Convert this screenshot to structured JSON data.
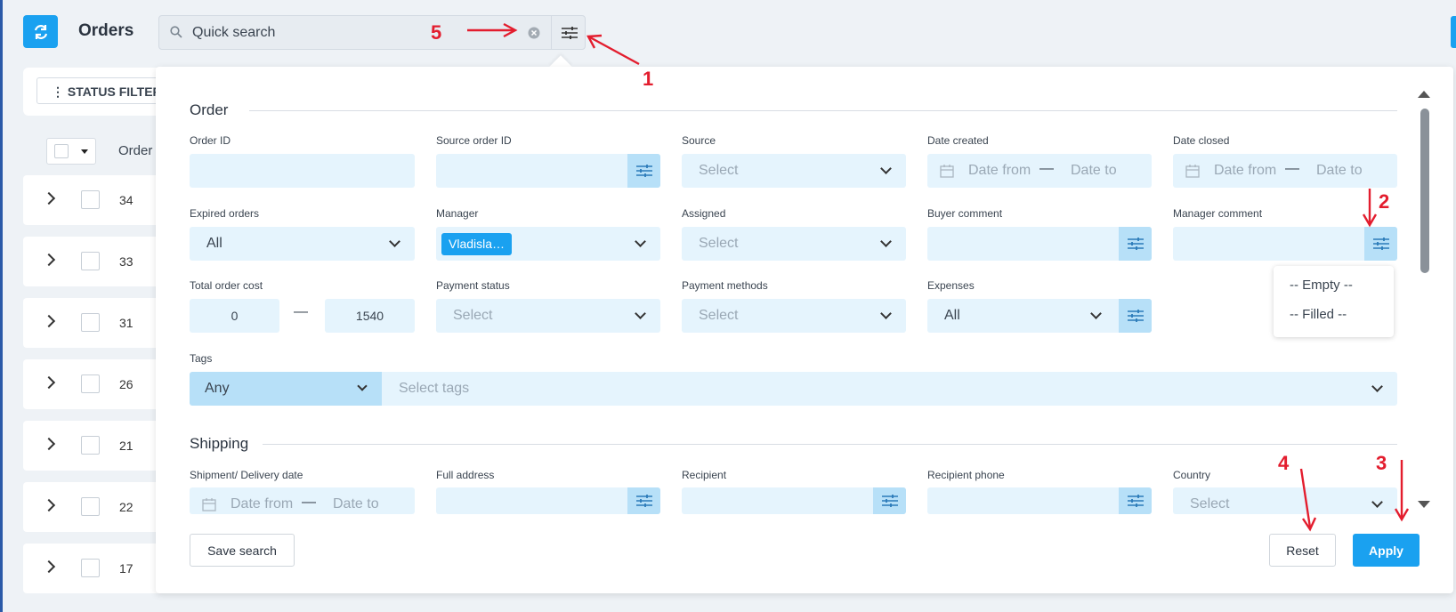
{
  "header": {
    "title": "Orders",
    "search_text": "Quick search"
  },
  "toolbar": {
    "status_filter_label": "⋮ STATUS FILTER"
  },
  "list": {
    "column_order": "Order",
    "rows": [
      "34",
      "33",
      "31",
      "26",
      "21",
      "22",
      "17"
    ]
  },
  "filter_panel": {
    "order_section": {
      "title": "Order",
      "order_id_label": "Order ID",
      "source_order_id_label": "Source order ID",
      "source_label": "Source",
      "source_placeholder": "Select",
      "date_created_label": "Date created",
      "date_closed_label": "Date closed",
      "date_from": "Date from",
      "date_to": "Date to",
      "date_dash": "—",
      "expired_label": "Expired orders",
      "expired_value": "All",
      "manager_label": "Manager",
      "manager_chip": "Vladisla…",
      "assigned_label": "Assigned",
      "assigned_placeholder": "Select",
      "buyer_comment_label": "Buyer comment",
      "manager_comment_label": "Manager comment",
      "total_cost_label": "Total order cost",
      "cost_min": "0",
      "cost_max": "1540",
      "cost_dash": "—",
      "payment_status_label": "Payment status",
      "payment_status_placeholder": "Select",
      "payment_methods_label": "Payment methods",
      "payment_methods_placeholder": "Select",
      "expenses_label": "Expenses",
      "expenses_value": "All",
      "tags_label": "Tags",
      "tags_mode": "Any",
      "tags_placeholder": "Select tags"
    },
    "comment_options": [
      "-- Empty --",
      "-- Filled --"
    ],
    "shipping_section": {
      "title": "Shipping",
      "delivery_date_label": "Shipment/ Delivery date",
      "date_from": "Date from",
      "date_to": "Date to",
      "date_dash": "—",
      "full_address_label": "Full address",
      "recipient_label": "Recipient",
      "recipient_phone_label": "Recipient phone",
      "country_label": "Country",
      "country_placeholder": "Select"
    },
    "footer": {
      "save_search": "Save search",
      "reset": "Reset",
      "apply": "Apply"
    }
  },
  "annotations": [
    "1",
    "2",
    "3",
    "4",
    "5"
  ],
  "colors": {
    "accent": "#1aa1f0",
    "field_bg": "#e5f4fd",
    "annotation": "#e31d2e"
  }
}
